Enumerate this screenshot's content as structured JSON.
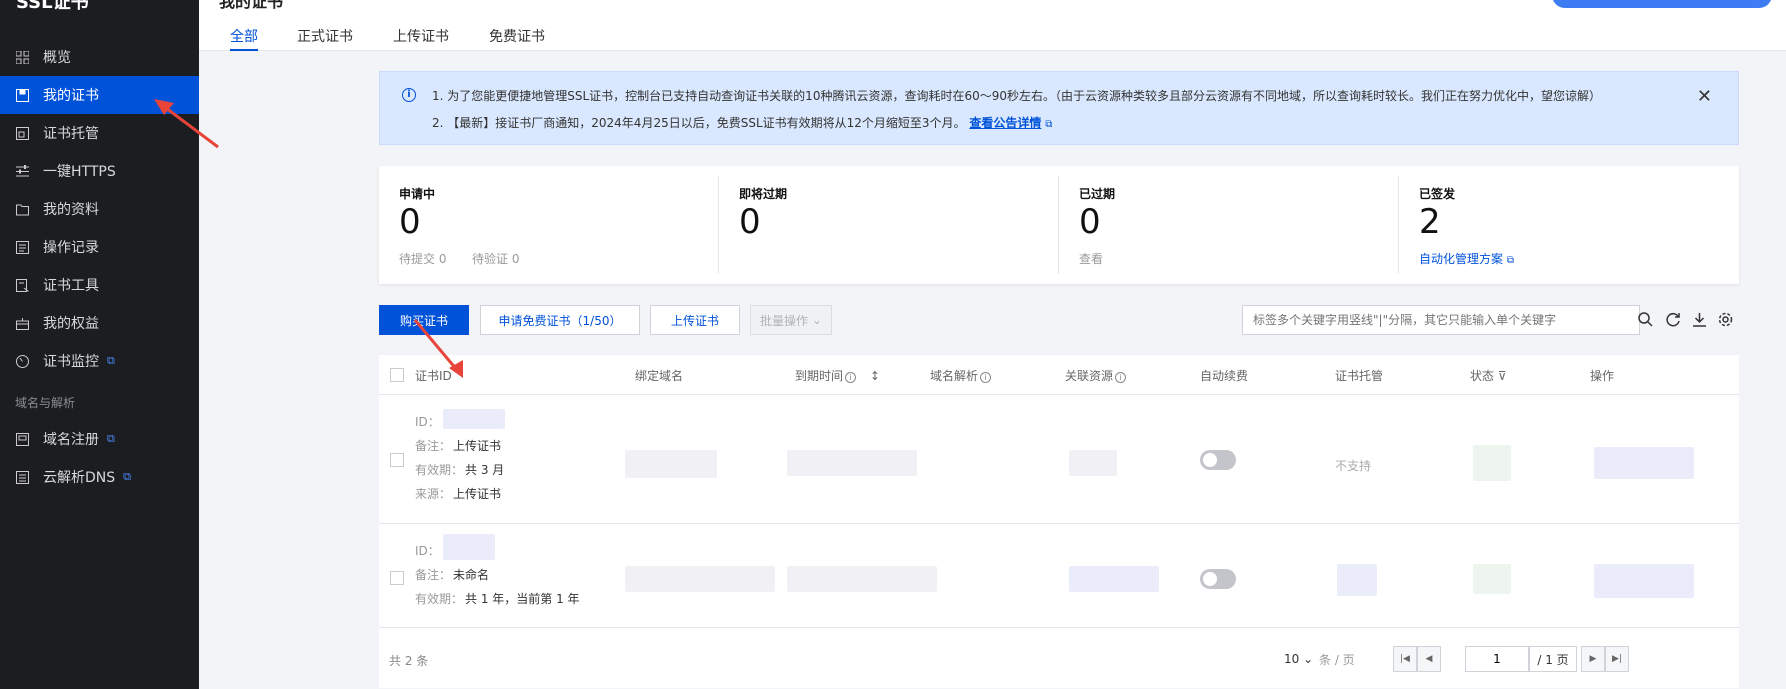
{
  "app": {
    "brand": "SSL证书",
    "page_title": "我的证书"
  },
  "colors": {
    "accent": "#0052d9",
    "sidebar_bg": "#1c1d21",
    "notice_bg": "#d9e8ff",
    "annotation_arrow": "#e8443a"
  },
  "sidebar": {
    "items": [
      {
        "label": "概览",
        "icon": "grid-icon"
      },
      {
        "label": "我的证书",
        "icon": "certificate-icon",
        "active": true
      },
      {
        "label": "证书托管",
        "icon": "hosting-icon"
      },
      {
        "label": "一键HTTPS",
        "icon": "sliders-icon"
      },
      {
        "label": "我的资料",
        "icon": "folder-icon"
      },
      {
        "label": "操作记录",
        "icon": "log-icon"
      },
      {
        "label": "证书工具",
        "icon": "tool-icon"
      },
      {
        "label": "我的权益",
        "icon": "gift-icon"
      },
      {
        "label": "证书监控",
        "icon": "monitor-icon",
        "external": true
      }
    ],
    "group_label": "域名与解析",
    "group_items": [
      {
        "label": "域名注册",
        "icon": "domain-icon",
        "external": true
      },
      {
        "label": "云解析DNS",
        "icon": "dns-icon",
        "external": true
      }
    ]
  },
  "tabs": [
    "全部",
    "正式证书",
    "上传证书",
    "免费证书"
  ],
  "notice": {
    "line1": "1. 为了您能更便捷地管理SSL证书，控制台已支持自动查询证书关联的10种腾讯云资源，查询耗时在60～90秒左右。（由于云资源种类较多且部分云资源有不同地域，所以查询耗时较长。我们正在努力优化中，望您谅解）",
    "line2": "2. 【最新】接证书厂商通知，2024年4月25日以后，免费SSL证书有效期将从12个月缩短至3个月。",
    "link": "查看公告详情"
  },
  "stats": [
    {
      "label": "申请中",
      "value": "0",
      "sub1": "待提交 0",
      "sub2": "待验证 0"
    },
    {
      "label": "即将过期",
      "value": "0"
    },
    {
      "label": "已过期",
      "value": "0",
      "sub1": "查看"
    },
    {
      "label": "已签发",
      "value": "2",
      "link": "自动化管理方案"
    }
  ],
  "toolbar": {
    "buy": "购买证书",
    "apply_free": "申请免费证书（1/50）",
    "upload": "上传证书",
    "batch": "批量操作",
    "search_placeholder": "标签多个关键字用竖线\"|\"分隔，其它只能输入单个关键字"
  },
  "table": {
    "columns": [
      "证书ID",
      "绑定域名",
      "到期时间",
      "域名解析",
      "关联资源",
      "自动续费",
      "证书托管",
      "状态",
      "操作"
    ],
    "rows": [
      {
        "id_label": "ID：",
        "note_label": "备注：",
        "note": "上传证书",
        "validity_label": "有效期：",
        "validity": "共 3 月",
        "source_label": "来源：",
        "source": "上传证书",
        "hosting": "不支持"
      },
      {
        "id_label": "ID：",
        "note_label": "备注：",
        "note": "未命名",
        "validity_label": "有效期：",
        "validity": "共 1 年，当前第 1 年"
      }
    ]
  },
  "pagination": {
    "total": "共 2 条",
    "page_size": "10",
    "per_page": "条 / 页",
    "current": "1",
    "total_pages": "/ 1 页"
  }
}
